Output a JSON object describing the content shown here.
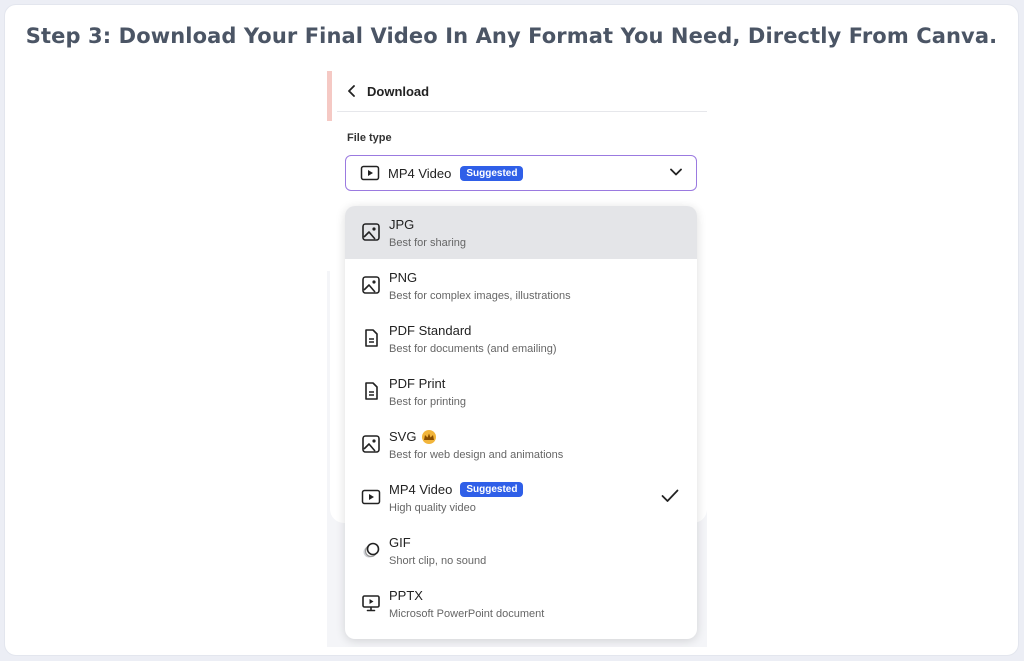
{
  "heading": "Step 3: Download Your Final Video In Any Format You Need, Directly From Canva.",
  "panel": {
    "back_label": "Download",
    "file_type_label": "File type",
    "selected_value": "MP4 Video",
    "selected_badge": "Suggested"
  },
  "options": [
    {
      "name": "JPG",
      "desc": "Best for sharing",
      "icon": "image-icon"
    },
    {
      "name": "PNG",
      "desc": "Best for complex images, illustrations",
      "icon": "image-icon"
    },
    {
      "name": "PDF Standard",
      "desc": "Best for documents (and emailing)",
      "icon": "document-icon"
    },
    {
      "name": "PDF Print",
      "desc": "Best for printing",
      "icon": "document-icon"
    },
    {
      "name": "SVG",
      "desc": "Best for web design and animations",
      "icon": "image-icon",
      "premium": "crown-icon"
    },
    {
      "name": "MP4 Video",
      "desc": "High quality video",
      "icon": "video-icon",
      "badge": "Suggested",
      "selected": true
    },
    {
      "name": "GIF",
      "desc": "Short clip, no sound",
      "icon": "gif-icon"
    },
    {
      "name": "PPTX",
      "desc": "Microsoft PowerPoint document",
      "icon": "presentation-icon"
    }
  ],
  "colors": {
    "accent_border": "#9b7ae0",
    "badge_blue": "#2f5fe8",
    "highlight_row": "#e4e5e8",
    "crown_gold": "#f2b53b"
  }
}
